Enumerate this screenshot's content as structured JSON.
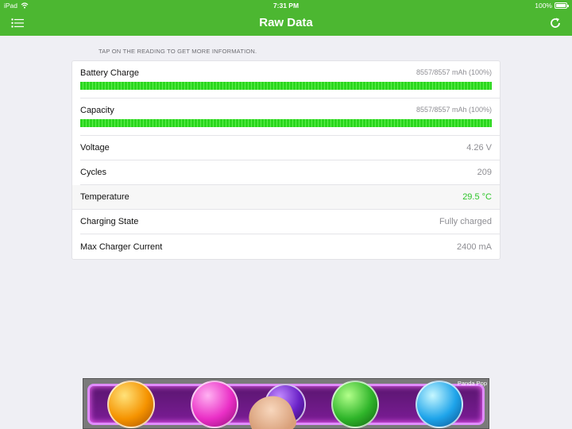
{
  "status_bar": {
    "device": "iPad",
    "time": "7:31 PM",
    "battery_percent": "100%"
  },
  "nav": {
    "title": "Raw Data",
    "menu_icon": "list-icon",
    "refresh_icon": "refresh-icon"
  },
  "hint": "TAP ON THE READING TO GET MORE INFORMATION.",
  "readings": {
    "battery_charge": {
      "label": "Battery Charge",
      "value": "8557/8557 mAh (100%)",
      "fill_fraction": 1.0
    },
    "capacity": {
      "label": "Capacity",
      "value": "8557/8557 mAh (100%)",
      "fill_fraction": 1.0
    },
    "voltage": {
      "label": "Voltage",
      "value": "4.26 V"
    },
    "cycles": {
      "label": "Cycles",
      "value": "209"
    },
    "temperature": {
      "label": "Temperature",
      "value": "29.5 °C"
    },
    "charging_state": {
      "label": "Charging State",
      "value": "Fully charged"
    },
    "max_charger_current": {
      "label": "Max Charger Current",
      "value": "2400 mA"
    }
  },
  "ad": {
    "label": "Panda Pop"
  },
  "colors": {
    "accent": "#4cb731",
    "bar_fill": "#2bd61e",
    "temperature_value": "#2ec52a"
  }
}
